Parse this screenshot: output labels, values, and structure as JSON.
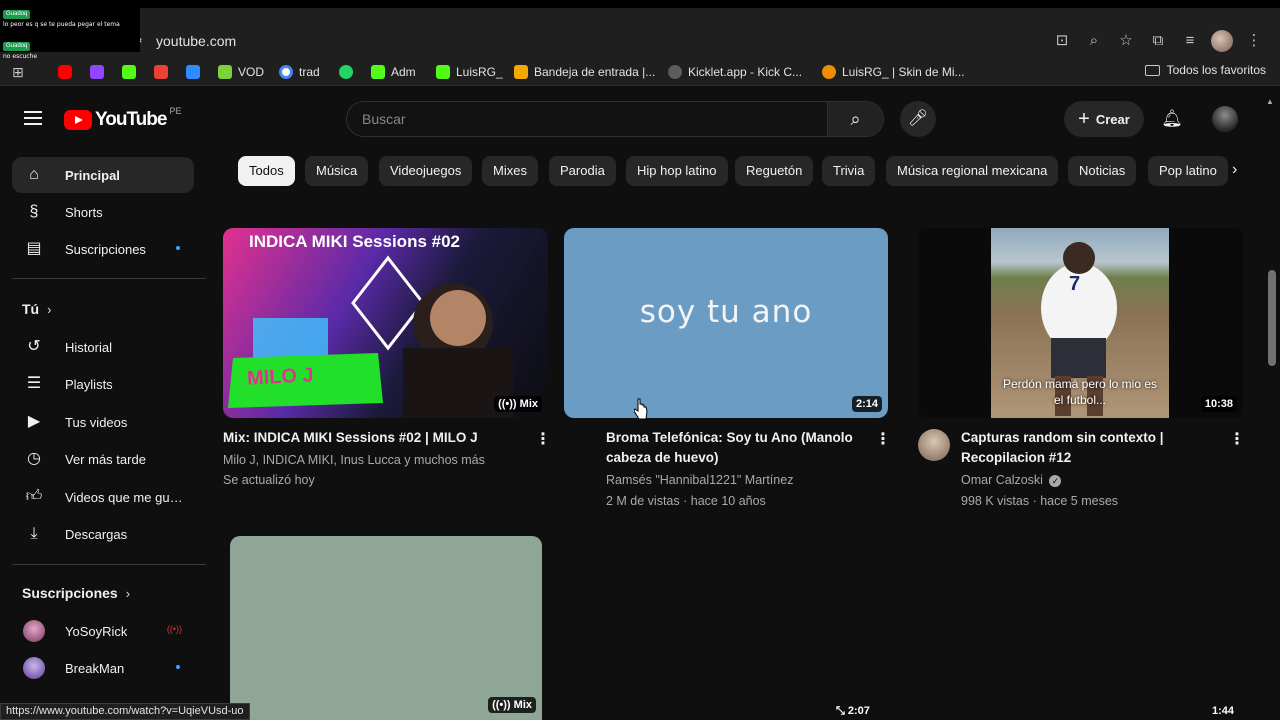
{
  "browser": {
    "url": "youtube.com",
    "status_url": "https://www.youtube.com/watch?v=UqieVUsd-uo",
    "notification": {
      "tag1": "Guadoq",
      "msg1": "lo peor es q se te pueda pegar el tema",
      "tag2": "Guadoq",
      "msg2": "no escuche"
    },
    "bookmarks": [
      {
        "label": "",
        "icon": "youtube-icon",
        "color": "#ff0000"
      },
      {
        "label": "",
        "icon": "twitch-icon",
        "color": "#9146ff"
      },
      {
        "label": "",
        "icon": "kick-icon",
        "color": "#53fc18"
      },
      {
        "label": "",
        "icon": "gmail-icon",
        "color": "#ea4335"
      },
      {
        "label": "",
        "icon": "app-icon",
        "color": "#2d8cff"
      },
      {
        "label": "VOD",
        "icon": "vod-icon",
        "color": "#7fd13b"
      },
      {
        "label": "trad",
        "icon": "google-icon",
        "color": "#4285f4"
      },
      {
        "label": "",
        "icon": "whatsapp-icon",
        "color": "#25d366"
      },
      {
        "label": "Adm",
        "icon": "kick-icon",
        "color": "#53fc18"
      },
      {
        "label": "LuisRG_",
        "icon": "kick-icon",
        "color": "#53fc18"
      },
      {
        "label": "Bandeja de entrada |...",
        "icon": "mail-icon",
        "color": "#f2a900"
      },
      {
        "label": "Kicklet.app - Kick C...",
        "icon": "kicklet-icon",
        "color": "#5c5c5c"
      },
      {
        "label": "LuisRG_ | Skin de Mi...",
        "icon": "skin-icon",
        "color": "#f08c00"
      }
    ],
    "all_bookmarks": "Todos los favoritos"
  },
  "header": {
    "logo": "YouTube",
    "country": "PE",
    "search_placeholder": "Buscar",
    "create_label": "Crear"
  },
  "sidebar": {
    "main": [
      {
        "label": "Principal",
        "icon": "home-icon"
      },
      {
        "label": "Shorts",
        "icon": "shorts-icon"
      },
      {
        "label": "Suscripciones",
        "icon": "subscriptions-icon"
      }
    ],
    "you_heading": "Tú",
    "you": [
      {
        "label": "Historial",
        "icon": "history-icon"
      },
      {
        "label": "Playlists",
        "icon": "playlists-icon"
      },
      {
        "label": "Tus videos",
        "icon": "your-videos-icon"
      },
      {
        "label": "Ver más tarde",
        "icon": "watch-later-icon"
      },
      {
        "label": "Videos que me gus...",
        "icon": "like-icon"
      },
      {
        "label": "Descargas",
        "icon": "download-icon"
      }
    ],
    "subs_heading": "Suscripciones",
    "subs": [
      {
        "label": "YoSoyRick",
        "color": "#c05b8a"
      },
      {
        "label": "BreakMan",
        "color": "#9d7bd8"
      }
    ]
  },
  "chips": [
    "Todos",
    "Música",
    "Videojuegos",
    "Mixes",
    "Parodia",
    "Hip hop latino",
    "Reguetón",
    "Trivia",
    "Música regional mexicana",
    "Noticias",
    "Pop latino"
  ],
  "videos": [
    {
      "title": "Mix: INDICA MIKI Sessions #02 | MILO J",
      "meta1": "Milo J, INDICA MIKI, Inus Lucca y muchos más",
      "meta2": "Se actualizó hoy",
      "badge": "Mix",
      "thumb_text_top": "INDICA MIKI Sessions #02",
      "thumb_text_bottom": "MILO J"
    },
    {
      "title1": "Broma Telefónica: Soy tu Ano (Manolo",
      "title2": "cabeza de huevo)",
      "channel": "Ramsés \"Hannibal1221\" Martínez",
      "stats": "2 M de vistas · hace 10 años",
      "badge": "2:14",
      "thumb_text": "soy tu ano"
    },
    {
      "title1": "Capturas random sin contexto |",
      "title2": "Recopilacion #12",
      "channel": "Omar Calzoski",
      "stats": "998 K vistas · hace 5 meses",
      "badge": "10:38",
      "thumb_caption1": "Perdón mamá pero lo mio es",
      "thumb_caption2": "el futbol...",
      "jersey": "7"
    }
  ],
  "row2": {
    "badge1": "Mix",
    "badge2": "2:07",
    "badge3": "1:44"
  }
}
